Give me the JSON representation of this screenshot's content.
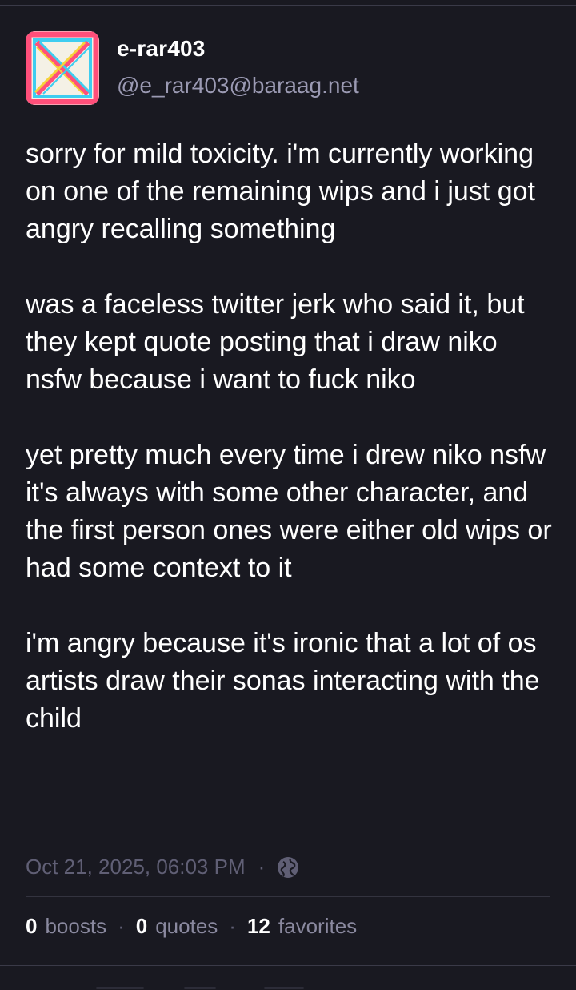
{
  "post": {
    "author": {
      "display_name": "e-rar403",
      "handle": "@e_rar403@baraag.net"
    },
    "content": {
      "paragraphs": [
        "sorry for mild toxicity. i'm currently working on one of the remaining wips and i just got angry recalling something",
        "was a faceless twitter jerk who said it, but they kept quote posting that i draw niko nsfw because i want to fuck niko",
        "yet pretty much every time i drew niko nsfw it's always with some other character, and the first person ones were either old wips or had some context to it",
        "i'm angry because it's ironic that a lot of os artists draw their sonas interacting with the child"
      ]
    },
    "timestamp": "Oct 21, 2025, 06:03 PM",
    "meta_separator": "·",
    "visibility_icon": "globe-icon",
    "stats": {
      "boosts_count": "0",
      "boosts_label": "boosts",
      "quotes_count": "0",
      "quotes_label": "quotes",
      "favorites_count": "12",
      "favorites_label": "favorites",
      "separator": "·"
    }
  },
  "colors": {
    "background": "#191921",
    "text_primary": "#ffffff",
    "text_secondary": "#9b9ab3",
    "text_muted": "#605f75",
    "divider": "#33333f"
  }
}
